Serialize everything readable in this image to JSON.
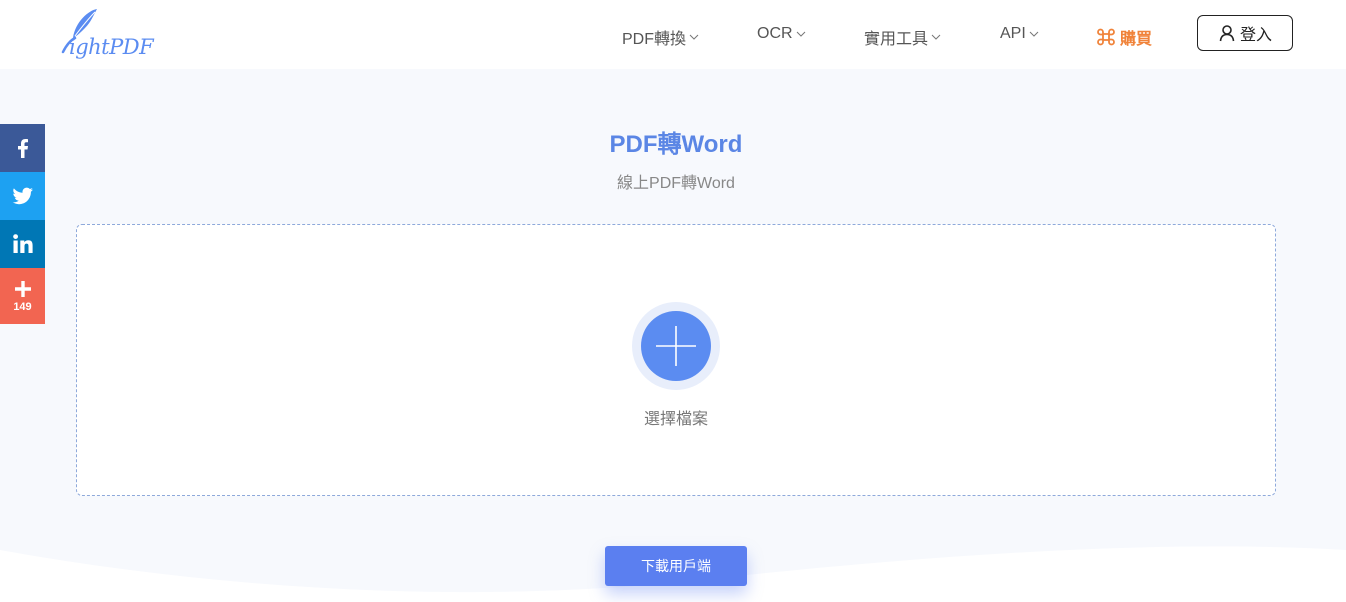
{
  "header": {
    "logo_text": "LightPDF",
    "nav": [
      {
        "label": "PDF轉換"
      },
      {
        "label": "OCR"
      },
      {
        "label": "實用工具"
      },
      {
        "label": "API"
      }
    ],
    "buy_label": "購買",
    "login_label": "登入"
  },
  "social": {
    "items": [
      {
        "name": "facebook",
        "icon": "facebook-icon"
      },
      {
        "name": "twitter",
        "icon": "twitter-icon"
      },
      {
        "name": "linkedin",
        "icon": "linkedin-icon"
      },
      {
        "name": "more",
        "icon": "plus-icon"
      }
    ],
    "share_count": "149"
  },
  "main": {
    "title": "PDF轉Word",
    "subtitle": "線上PDF轉Word",
    "upload": {
      "icon": "plus-icon",
      "label": "選擇檔案"
    },
    "download_label": "下載用戶端"
  },
  "colors": {
    "brand_blue": "#5b86e5",
    "buy_orange": "#f0833a",
    "facebook": "#3b5998",
    "twitter": "#1da1f2",
    "linkedin": "#0077b5",
    "share": "#f26551"
  }
}
